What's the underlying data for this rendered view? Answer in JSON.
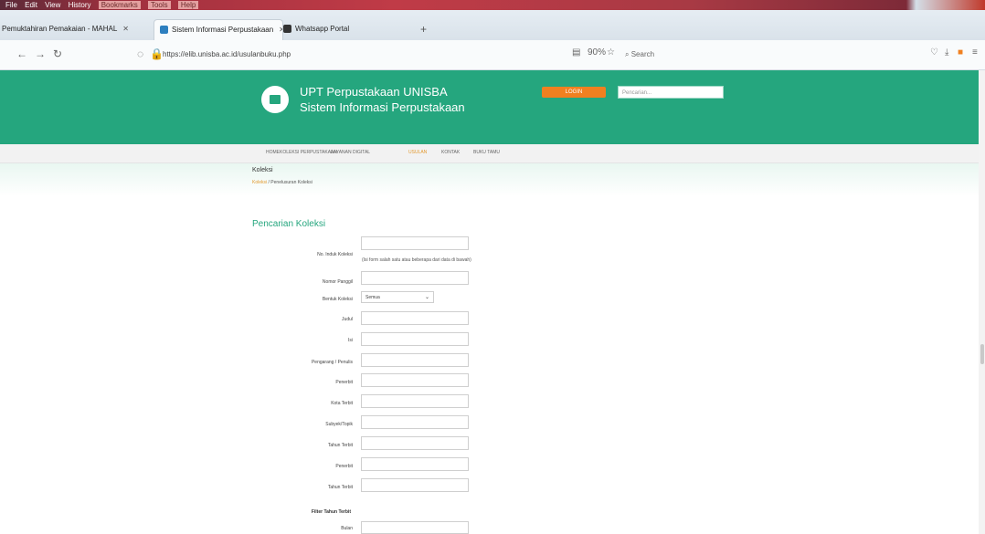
{
  "browser": {
    "menu": [
      "File",
      "Edit",
      "View",
      "History",
      "Bookmarks",
      "Tools",
      "Help"
    ],
    "tabs": [
      {
        "label": "Pemuktahiran Pemakaian - MAHAL"
      },
      {
        "label": "Sistem Informasi Perpustakaan"
      },
      {
        "label": "Whatsapp Portal"
      }
    ],
    "url": "https://elib.unisba.ac.id/usulanbuku.php",
    "url_domain": "unisba.ac.id",
    "zoom": "90%",
    "search_placeholder": "Search"
  },
  "site": {
    "title_line1": "UPT Perpustakaan UNISBA",
    "title_line2": "Sistem Informasi Perpustakaan",
    "login_label": "LOGIN",
    "search_placeholder": "Pencarian...",
    "menu": [
      {
        "label": "HOME",
        "active": false
      },
      {
        "label": "KOLEKSI PERPUSTAKAAN",
        "active": false
      },
      {
        "label": "LAYANAN DIGITAL",
        "active": false
      },
      {
        "label": "USULAN",
        "active": true
      },
      {
        "label": "KONTAK",
        "active": false
      },
      {
        "label": "BUKU TAMU",
        "active": false
      }
    ]
  },
  "page": {
    "title": "Koleksi",
    "breadcrumb_home": "Koleksi",
    "breadcrumb_sep": " / ",
    "breadcrumb_current": "Penelusuran Koleksi"
  },
  "form": {
    "title": "Pencarian Koleksi",
    "hint": "(Isi form salah satu atau beberapa dari data di bawah)",
    "fields": [
      {
        "label": "No. Induk Koleksi"
      },
      {
        "label": "Nomor Panggil"
      },
      {
        "label": "Bentuk Koleksi"
      },
      {
        "label": "Judul"
      },
      {
        "label": "Isi"
      },
      {
        "label": "Pengarang / Penulis"
      },
      {
        "label": "Penerbit"
      },
      {
        "label": "Kota Terbit"
      },
      {
        "label": "Subyek/Topik"
      },
      {
        "label": "Tahun Terbit"
      },
      {
        "label": "Penerbit"
      },
      {
        "label": "Tahun Terbit"
      }
    ],
    "select_value": "Semua",
    "section_label": "Filter Tahun Terbit",
    "last_field_label": "Bulan"
  }
}
